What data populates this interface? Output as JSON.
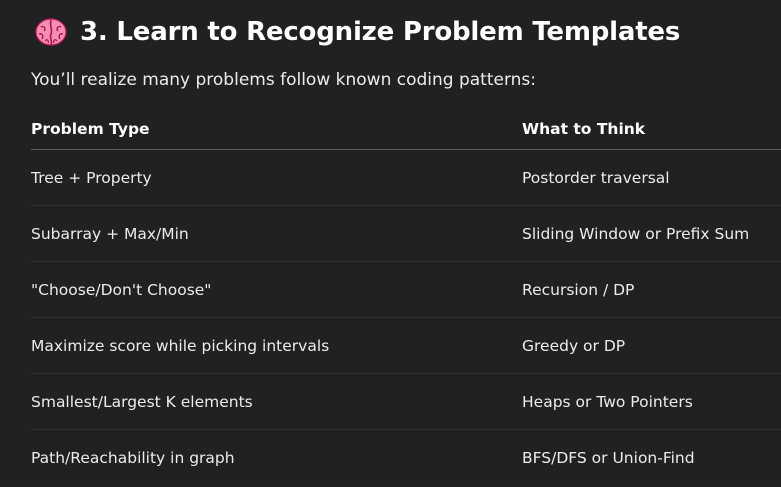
{
  "section": {
    "icon": "brain-icon",
    "title": "3. Learn to Recognize Problem Templates",
    "intro": "You’ll realize many problems follow known coding patterns:"
  },
  "table": {
    "headers": [
      "Problem Type",
      "What to Think"
    ],
    "rows": [
      [
        "Tree + Property",
        "Postorder traversal"
      ],
      [
        "Subarray + Max/Min",
        "Sliding Window or Prefix Sum"
      ],
      [
        "\"Choose/Don't Choose\"",
        "Recursion / DP"
      ],
      [
        "Maximize score while picking intervals",
        "Greedy or DP"
      ],
      [
        "Smallest/Largest K elements",
        "Heaps or Two Pointers"
      ],
      [
        "Path/Reachability in graph",
        "BFS/DFS or Union-Find"
      ]
    ]
  },
  "colors": {
    "background": "#212121",
    "text": "#ececec",
    "brain": "#f48fb1"
  }
}
